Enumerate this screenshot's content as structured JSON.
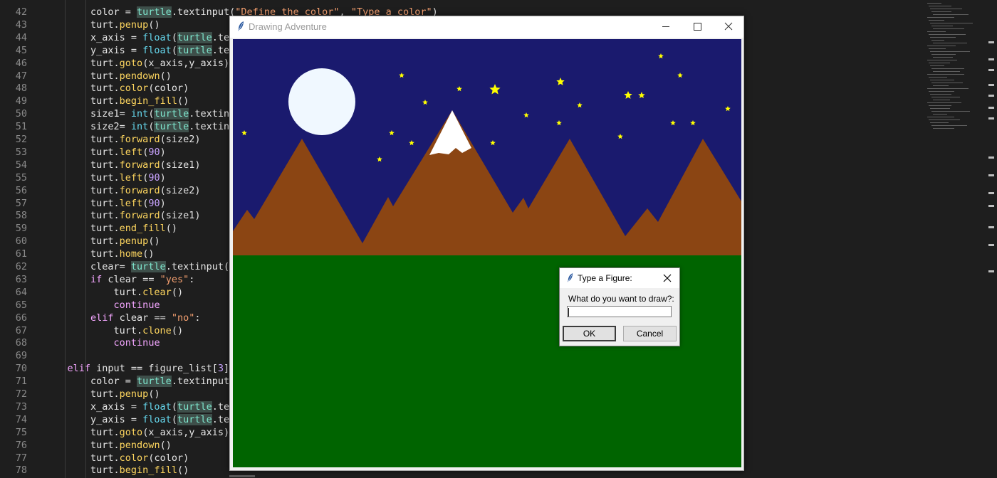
{
  "editor": {
    "lines": [
      {
        "n": "42",
        "segs": [
          {
            "t": "        color = ",
            "c": ""
          },
          {
            "t": "turtle",
            "c": "hl"
          },
          {
            "t": ".textinput(",
            "c": ""
          },
          {
            "t": "\"Define the color\"",
            "c": "str"
          },
          {
            "t": ", ",
            "c": ""
          },
          {
            "t": "\"Type a color\"",
            "c": "str"
          },
          {
            "t": ")",
            "c": ""
          }
        ]
      },
      {
        "n": "43",
        "segs": [
          {
            "t": "        turt.",
            "c": ""
          },
          {
            "t": "penup",
            "c": "fn"
          },
          {
            "t": "()",
            "c": ""
          }
        ]
      },
      {
        "n": "44",
        "segs": [
          {
            "t": "        x_axis = ",
            "c": ""
          },
          {
            "t": "float",
            "c": "builtin"
          },
          {
            "t": "(",
            "c": ""
          },
          {
            "t": "turtle",
            "c": "hl"
          },
          {
            "t": ".te",
            "c": ""
          }
        ]
      },
      {
        "n": "45",
        "segs": [
          {
            "t": "        y_axis = ",
            "c": ""
          },
          {
            "t": "float",
            "c": "builtin"
          },
          {
            "t": "(",
            "c": ""
          },
          {
            "t": "turtle",
            "c": "hl"
          },
          {
            "t": ".te",
            "c": ""
          }
        ]
      },
      {
        "n": "46",
        "segs": [
          {
            "t": "        turt.",
            "c": ""
          },
          {
            "t": "goto",
            "c": "fn"
          },
          {
            "t": "(x_axis,y_axis)",
            "c": ""
          }
        ]
      },
      {
        "n": "47",
        "segs": [
          {
            "t": "        turt.",
            "c": ""
          },
          {
            "t": "pendown",
            "c": "fn"
          },
          {
            "t": "()",
            "c": ""
          }
        ]
      },
      {
        "n": "48",
        "segs": [
          {
            "t": "        turt.",
            "c": ""
          },
          {
            "t": "color",
            "c": "fn"
          },
          {
            "t": "(color)",
            "c": ""
          }
        ]
      },
      {
        "n": "49",
        "segs": [
          {
            "t": "        turt.",
            "c": ""
          },
          {
            "t": "begin_fill",
            "c": "fn"
          },
          {
            "t": "()",
            "c": ""
          }
        ]
      },
      {
        "n": "50",
        "segs": [
          {
            "t": "        size1= ",
            "c": ""
          },
          {
            "t": "int",
            "c": "builtin"
          },
          {
            "t": "(",
            "c": ""
          },
          {
            "t": "turtle",
            "c": "hl"
          },
          {
            "t": ".textin",
            "c": ""
          }
        ]
      },
      {
        "n": "51",
        "segs": [
          {
            "t": "        size2= ",
            "c": ""
          },
          {
            "t": "int",
            "c": "builtin"
          },
          {
            "t": "(",
            "c": ""
          },
          {
            "t": "turtle",
            "c": "hl"
          },
          {
            "t": ".textin",
            "c": ""
          }
        ]
      },
      {
        "n": "52",
        "segs": [
          {
            "t": "        turt.",
            "c": ""
          },
          {
            "t": "forward",
            "c": "fn"
          },
          {
            "t": "(size2)",
            "c": ""
          }
        ]
      },
      {
        "n": "53",
        "segs": [
          {
            "t": "        turt.",
            "c": ""
          },
          {
            "t": "left",
            "c": "fn"
          },
          {
            "t": "(",
            "c": ""
          },
          {
            "t": "90",
            "c": "num"
          },
          {
            "t": ")",
            "c": ""
          }
        ]
      },
      {
        "n": "54",
        "segs": [
          {
            "t": "        turt.",
            "c": ""
          },
          {
            "t": "forward",
            "c": "fn"
          },
          {
            "t": "(size1)",
            "c": ""
          }
        ]
      },
      {
        "n": "55",
        "segs": [
          {
            "t": "        turt.",
            "c": ""
          },
          {
            "t": "left",
            "c": "fn"
          },
          {
            "t": "(",
            "c": ""
          },
          {
            "t": "90",
            "c": "num"
          },
          {
            "t": ")",
            "c": ""
          }
        ]
      },
      {
        "n": "56",
        "segs": [
          {
            "t": "        turt.",
            "c": ""
          },
          {
            "t": "forward",
            "c": "fn"
          },
          {
            "t": "(size2)",
            "c": ""
          }
        ]
      },
      {
        "n": "57",
        "segs": [
          {
            "t": "        turt.",
            "c": ""
          },
          {
            "t": "left",
            "c": "fn"
          },
          {
            "t": "(",
            "c": ""
          },
          {
            "t": "90",
            "c": "num"
          },
          {
            "t": ")",
            "c": ""
          }
        ]
      },
      {
        "n": "58",
        "segs": [
          {
            "t": "        turt.",
            "c": ""
          },
          {
            "t": "forward",
            "c": "fn"
          },
          {
            "t": "(size1)",
            "c": ""
          }
        ]
      },
      {
        "n": "59",
        "segs": [
          {
            "t": "        turt.",
            "c": ""
          },
          {
            "t": "end_fill",
            "c": "fn"
          },
          {
            "t": "()",
            "c": ""
          }
        ]
      },
      {
        "n": "60",
        "segs": [
          {
            "t": "        turt.",
            "c": ""
          },
          {
            "t": "penup",
            "c": "fn"
          },
          {
            "t": "()",
            "c": ""
          }
        ]
      },
      {
        "n": "61",
        "segs": [
          {
            "t": "        turt.",
            "c": ""
          },
          {
            "t": "home",
            "c": "fn"
          },
          {
            "t": "()",
            "c": ""
          }
        ]
      },
      {
        "n": "62",
        "segs": [
          {
            "t": "        clear= ",
            "c": ""
          },
          {
            "t": "turtle",
            "c": "hl"
          },
          {
            "t": ".textinput(",
            "c": ""
          }
        ]
      },
      {
        "n": "63",
        "segs": [
          {
            "t": "        ",
            "c": ""
          },
          {
            "t": "if",
            "c": "kw"
          },
          {
            "t": " clear == ",
            "c": ""
          },
          {
            "t": "\"yes\"",
            "c": "str"
          },
          {
            "t": ":",
            "c": ""
          }
        ]
      },
      {
        "n": "64",
        "segs": [
          {
            "t": "            turt.",
            "c": ""
          },
          {
            "t": "clear",
            "c": "fn"
          },
          {
            "t": "()",
            "c": ""
          }
        ]
      },
      {
        "n": "65",
        "segs": [
          {
            "t": "            ",
            "c": ""
          },
          {
            "t": "continue",
            "c": "kw"
          }
        ]
      },
      {
        "n": "66",
        "segs": [
          {
            "t": "        ",
            "c": ""
          },
          {
            "t": "elif",
            "c": "kw"
          },
          {
            "t": " clear == ",
            "c": ""
          },
          {
            "t": "\"no\"",
            "c": "str"
          },
          {
            "t": ":",
            "c": ""
          }
        ]
      },
      {
        "n": "67",
        "segs": [
          {
            "t": "            turt.",
            "c": ""
          },
          {
            "t": "clone",
            "c": "fn"
          },
          {
            "t": "()",
            "c": ""
          }
        ]
      },
      {
        "n": "68",
        "segs": [
          {
            "t": "            ",
            "c": ""
          },
          {
            "t": "continue",
            "c": "kw"
          }
        ]
      },
      {
        "n": "69",
        "segs": []
      },
      {
        "n": "70",
        "segs": [
          {
            "t": "    ",
            "c": ""
          },
          {
            "t": "elif",
            "c": "kw"
          },
          {
            "t": " input == figure_list[",
            "c": ""
          },
          {
            "t": "3",
            "c": "num"
          },
          {
            "t": "]",
            "c": ""
          }
        ]
      },
      {
        "n": "71",
        "segs": [
          {
            "t": "        color = ",
            "c": ""
          },
          {
            "t": "turtle",
            "c": "hl"
          },
          {
            "t": ".textinput(",
            "c": ""
          }
        ]
      },
      {
        "n": "72",
        "segs": [
          {
            "t": "        turt.",
            "c": ""
          },
          {
            "t": "penup",
            "c": "fn"
          },
          {
            "t": "()",
            "c": ""
          }
        ]
      },
      {
        "n": "73",
        "segs": [
          {
            "t": "        x_axis = ",
            "c": ""
          },
          {
            "t": "float",
            "c": "builtin"
          },
          {
            "t": "(",
            "c": ""
          },
          {
            "t": "turtle",
            "c": "hl"
          },
          {
            "t": ".te",
            "c": ""
          }
        ]
      },
      {
        "n": "74",
        "segs": [
          {
            "t": "        y_axis = ",
            "c": ""
          },
          {
            "t": "float",
            "c": "builtin"
          },
          {
            "t": "(",
            "c": ""
          },
          {
            "t": "turtle",
            "c": "hl"
          },
          {
            "t": ".te",
            "c": ""
          }
        ]
      },
      {
        "n": "75",
        "segs": [
          {
            "t": "        turt.",
            "c": ""
          },
          {
            "t": "goto",
            "c": "fn"
          },
          {
            "t": "(x_axis,y_axis)",
            "c": ""
          }
        ]
      },
      {
        "n": "76",
        "segs": [
          {
            "t": "        turt.",
            "c": ""
          },
          {
            "t": "pendown",
            "c": "fn"
          },
          {
            "t": "()",
            "c": ""
          }
        ]
      },
      {
        "n": "77",
        "segs": [
          {
            "t": "        turt.",
            "c": ""
          },
          {
            "t": "color",
            "c": "fn"
          },
          {
            "t": "(color)",
            "c": ""
          }
        ]
      },
      {
        "n": "78",
        "segs": [
          {
            "t": "        turt.",
            "c": ""
          },
          {
            "t": "begin_fill",
            "c": "fn"
          },
          {
            "t": "()",
            "c": ""
          }
        ]
      }
    ]
  },
  "turtle_window": {
    "title": "Drawing Adventure",
    "icons": [
      "feather-icon",
      "minimize-icon",
      "maximize-icon",
      "close-icon"
    ],
    "scene": {
      "sky_color": "#1a1a6e",
      "ground_color": "#006400",
      "mountain_color": "#8b4513",
      "snow_color": "#ffffff",
      "moon_color": "#f0f8ff",
      "star_color": "#ffff00"
    }
  },
  "dialog": {
    "title": "Type a Figure:",
    "prompt": "What do you want to draw?:",
    "input_value": "",
    "ok_label": "OK",
    "cancel_label": "Cancel",
    "icons": [
      "feather-icon",
      "close-icon"
    ]
  }
}
